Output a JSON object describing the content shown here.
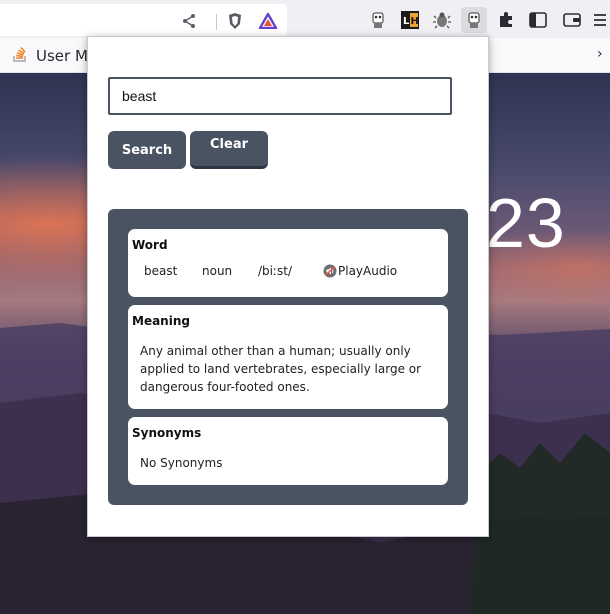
{
  "browser": {
    "bookmark_label": "User Ma"
  },
  "background": {
    "clock_text": "23"
  },
  "popup": {
    "search": {
      "value": "beast"
    },
    "buttons": {
      "search_label": "Search",
      "clear_label": "Clear"
    },
    "word_card": {
      "title": "Word",
      "word": "beast",
      "part_of_speech": "noun",
      "phonetic": "/biːst/",
      "audio_label": "PlayAudio"
    },
    "meaning_card": {
      "title": "Meaning",
      "text": "Any animal other than a human; usually only applied to land vertebrates, especially large or dangerous four-footed ones."
    },
    "synonyms_card": {
      "title": "Synonyms",
      "text": "No Synonyms"
    }
  },
  "colors": {
    "accent": "#4a5361",
    "popup_bg": "#ffffff",
    "brave_orange": "#e8542b"
  }
}
